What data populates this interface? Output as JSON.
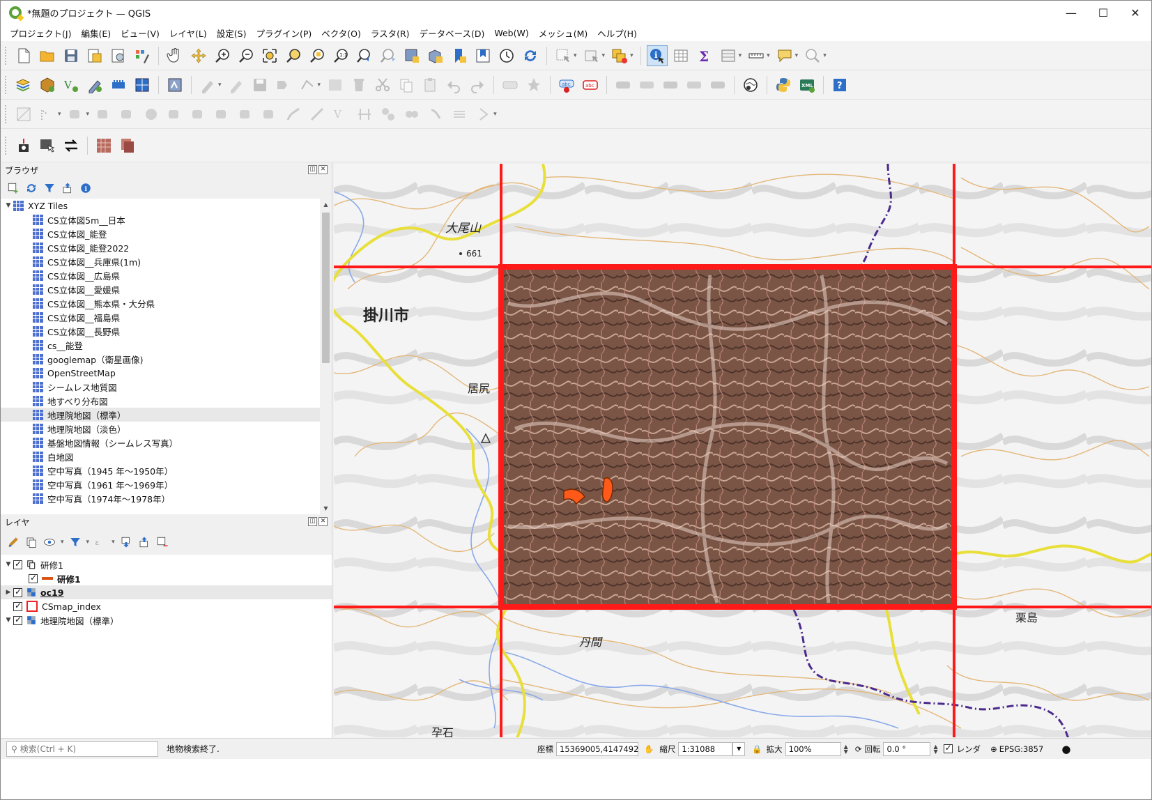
{
  "window": {
    "title": "*無題のプロジェクト — QGIS",
    "controls": [
      "minimize",
      "maximize",
      "close"
    ]
  },
  "menu": [
    "プロジェクト(J)",
    "編集(E)",
    "ビュー(V)",
    "レイヤ(L)",
    "設定(S)",
    "プラグイン(P)",
    "ベクタ(O)",
    "ラスタ(R)",
    "データベース(D)",
    "Web(W)",
    "メッシュ(M)",
    "ヘルプ(H)"
  ],
  "browser": {
    "title": "ブラウザ",
    "root": "XYZ Tiles",
    "items": [
      "CS立体図5m__日本",
      "CS立体図_能登",
      "CS立体図_能登2022",
      "CS立体図__兵庫県(1m)",
      "CS立体図__広島県",
      "CS立体図__愛媛県",
      "CS立体図__熊本県・大分県",
      "CS立体図__福島県",
      "CS立体図__長野県",
      "cs__能登",
      "googlemap（衛星画像)",
      "OpenStreetMap",
      "シームレス地質図",
      "地すべり分布図",
      "地理院地図（標準）",
      "地理院地図（淡色）",
      "基盤地図情報（シームレス写真）",
      "白地図",
      "空中写真（1945 年～1950年）",
      "空中写真（1961 年～1969年）",
      "空中写真（1974年～1978年）"
    ],
    "selected_index": 14
  },
  "layers": {
    "title": "レイヤ",
    "items": [
      {
        "name": "研修1",
        "type": "group",
        "checked": true
      },
      {
        "name": "研修1",
        "type": "line",
        "checked": true
      },
      {
        "name": "oc19",
        "type": "raster",
        "checked": true
      },
      {
        "name": "CSmap_index",
        "type": "polygon",
        "checked": true
      },
      {
        "name": "地理院地図（標準）",
        "type": "raster",
        "checked": true
      }
    ]
  },
  "map": {
    "labels": {
      "mountain": "大尾山",
      "elevation": "661",
      "city": "掛川市",
      "place1": "居尻",
      "place2": "丹間",
      "place3": "栗島",
      "place4": "孕石"
    },
    "colors": {
      "grid": "#ff1a1a",
      "contour": "#e0b070",
      "road": "#f0e34a",
      "boundary": "#4a2a8a",
      "feature": "#ff5a1a"
    }
  },
  "status": {
    "search_placeholder": "検索(Ctrl + K)",
    "message": "地物検索終了.",
    "coord_label": "座標",
    "coord_value": "15369005,4147492",
    "scale_label": "縮尺",
    "scale_value": "1:31088",
    "magnifier_label": "拡大",
    "magnifier_value": "100%",
    "rotation_label": "回転",
    "rotation_value": "0.0 °",
    "render_label": "レンダ",
    "crs": "EPSG:3857"
  }
}
